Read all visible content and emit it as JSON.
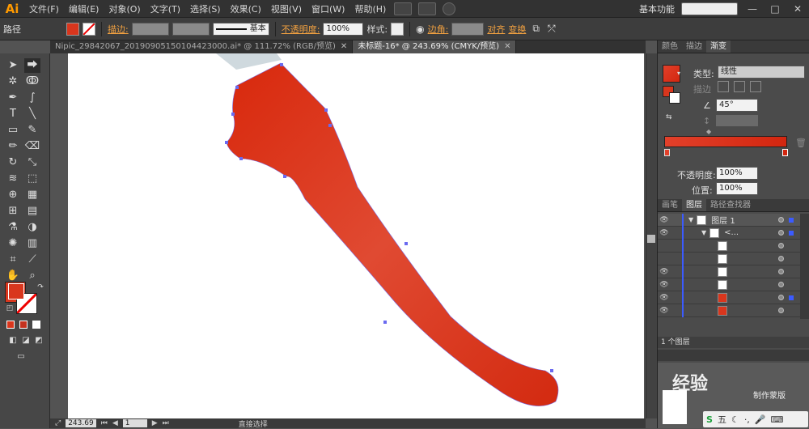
{
  "menubar": {
    "logo": "Ai",
    "items": [
      "文件(F)",
      "编辑(E)",
      "对象(O)",
      "文字(T)",
      "选择(S)",
      "效果(C)",
      "视图(V)",
      "窗口(W)",
      "帮助(H)"
    ],
    "workspace": "基本功能",
    "win_min": "—",
    "win_max": "□",
    "win_close": "✕"
  },
  "controlbar": {
    "path_label": "路径",
    "stroke_label": "描边:",
    "stroke_style": "基本",
    "opacity_label": "不透明度:",
    "opacity_value": "100%",
    "style_label": "样式:",
    "corner_label": "边角:",
    "align_label": "对齐",
    "transform_label": "变换"
  },
  "tabs": [
    {
      "label": "Nipic_29842067_20190905150104423000.ai* @ 111.72% (RGB/预览)",
      "close": "✕",
      "active": false
    },
    {
      "label": "未标题-16* @ 243.69% (CMYK/预览)",
      "close": "✕",
      "active": true
    }
  ],
  "status": {
    "zoom": "243.69",
    "page": "1",
    "tool": "直接选择"
  },
  "gradient_panel": {
    "tabs": [
      "颜色",
      "描边",
      "渐变"
    ],
    "type_label": "类型:",
    "type_value": "线性",
    "stroke_label": "描边",
    "angle_value": "45°",
    "opacity_label": "不透明度:",
    "opacity_value": "100%",
    "location_label": "位置:",
    "location_value": "100%",
    "start_color": "#e2402a",
    "end_color": "#d3260f"
  },
  "layers_panel": {
    "tabs": [
      "画笔",
      "图层",
      "路径查找器"
    ],
    "layer1_name": "图层 1",
    "group_name": "<...",
    "footer_count": "1 个图层"
  },
  "colors": {
    "fill": "#d9361d",
    "shape_light": "#e04a32",
    "shape_dark": "#d32a10"
  },
  "watermark": {
    "text1": "经验",
    "text2": "制作蒙版",
    "ime": "五"
  }
}
